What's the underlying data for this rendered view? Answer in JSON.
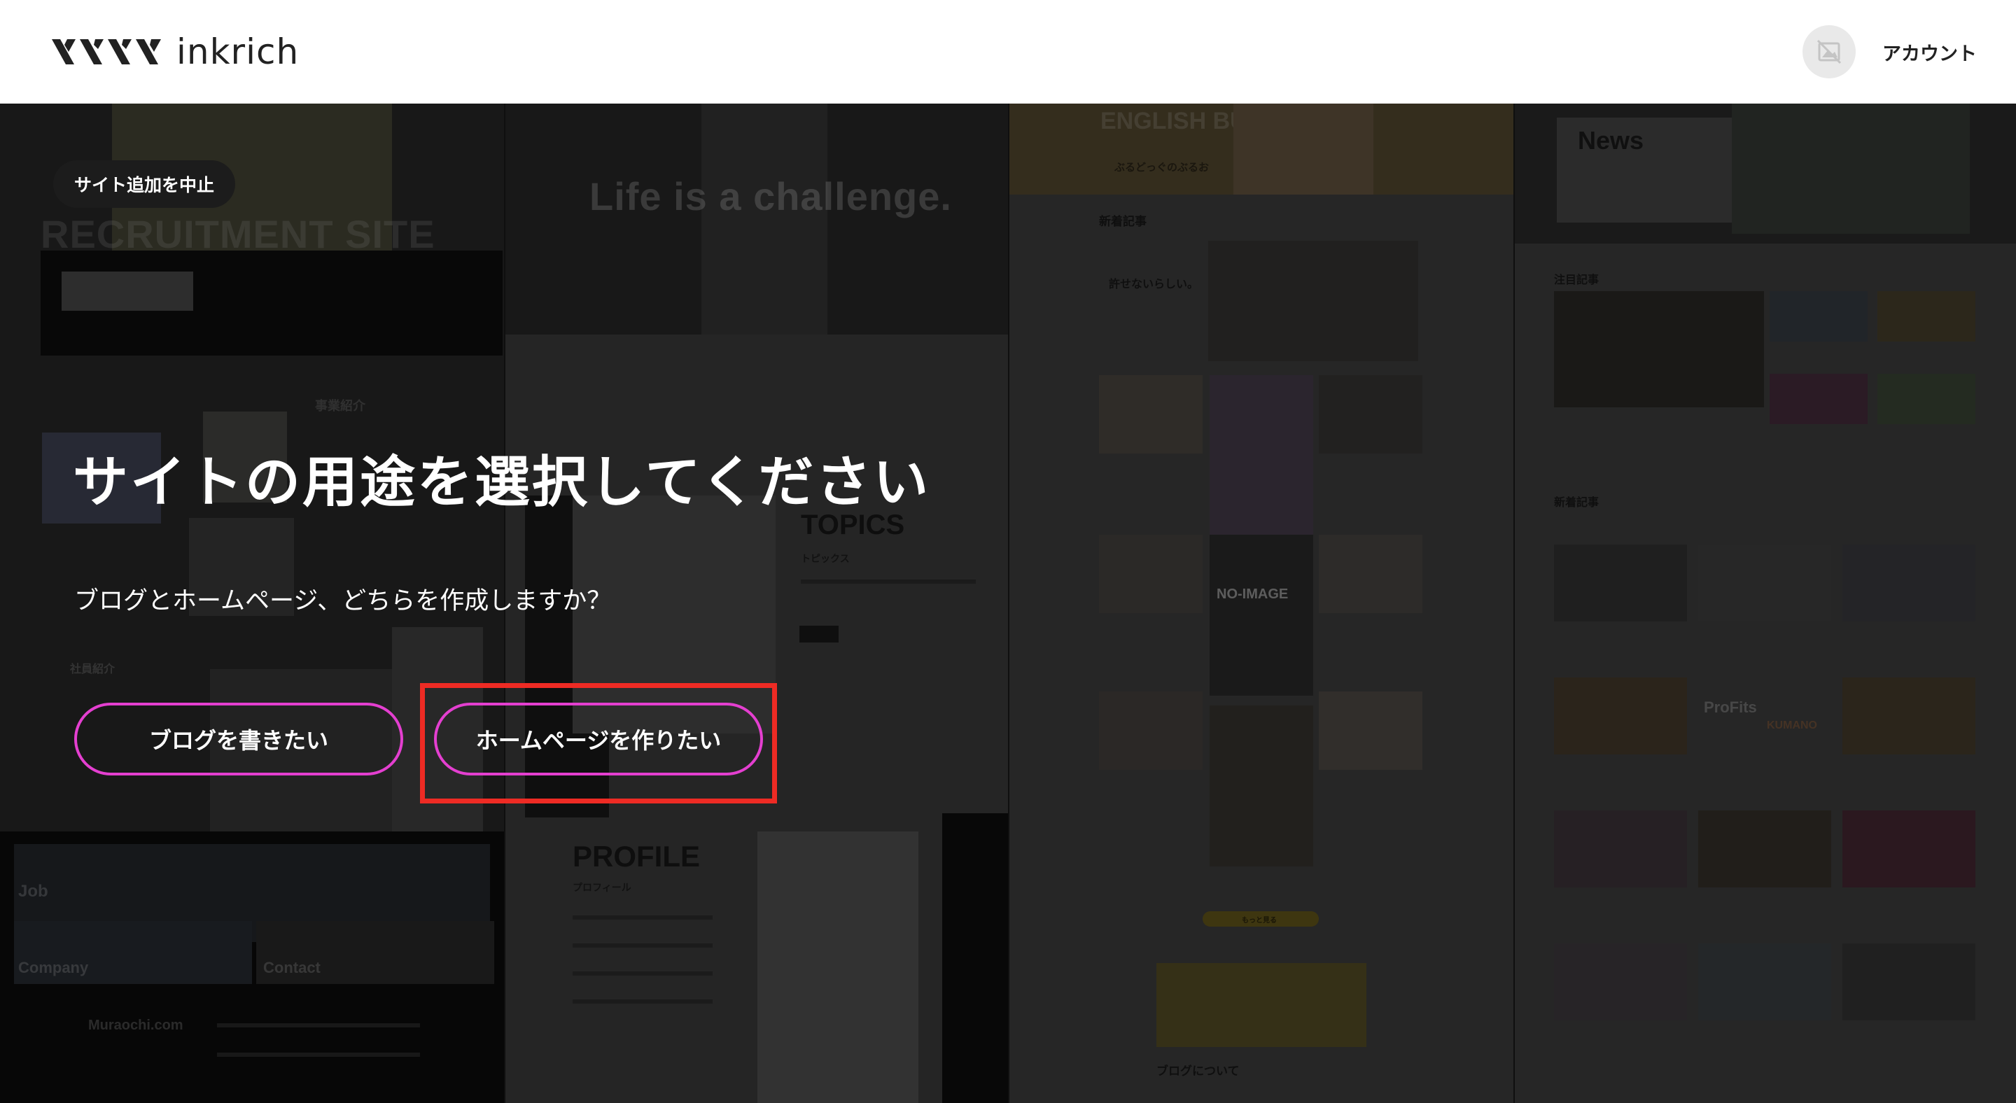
{
  "header": {
    "logo_text": "inkrich",
    "account_label": "アカウント",
    "account_icon": "no-image-avatar-icon"
  },
  "overlay": {
    "cancel_label": "サイト追加を中止",
    "title": "サイトの用途を選択してください",
    "subtitle": "ブログとホームページ、どちらを作成しますか？",
    "blog_button_label": "ブログを書きたい",
    "homepage_button_label": "ホームページを作りたい",
    "button_border_color": "#e43fd0",
    "highlight_color": "#ee2b24"
  },
  "preview": {
    "col1": {
      "hero": "RECRUITMENT SITE",
      "section1": "事業紹介",
      "section2": "社員紹介",
      "footer_items": [
        "Job",
        "Company",
        "Contact"
      ],
      "footer_domain": "Muraochi.com"
    },
    "col2": {
      "hero": "Life is a challenge.",
      "topics": "TOPICS",
      "topics_sub": "トピックス",
      "profile": "PROFILE",
      "profile_sub": "プロフィール"
    },
    "col3": {
      "banner": "ENGLISH BULLDOG",
      "blog_name": "ぶるどっぐのぶるお",
      "new_articles": "新着記事",
      "featured_title": "許せないらしい。",
      "no_image": "NO-IMAGE",
      "more_button": "もっと見る",
      "about": "ブログについて"
    },
    "col4": {
      "news": "News",
      "featured": "注目記事",
      "new_articles": "新着記事",
      "brand": "ProFits",
      "brand2": "KUMANO"
    }
  }
}
